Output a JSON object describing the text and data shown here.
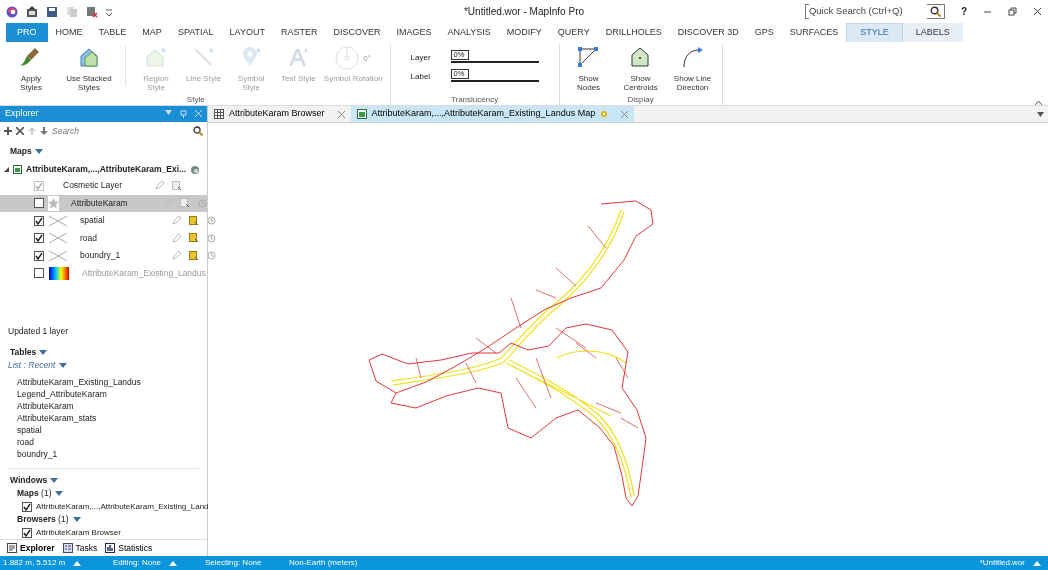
{
  "window": {
    "title": "*Untitled.wor - MapInfo Pro",
    "quick_search": {
      "placeholder": "Quick Search (Ctrl+Q)"
    },
    "help": "?"
  },
  "ribbon_tabs": [
    {
      "label": "PRO",
      "kind": "app",
      "selected": false
    },
    {
      "label": "HOME",
      "kind": "tab",
      "selected": false
    },
    {
      "label": "TABLE",
      "kind": "tab",
      "selected": false
    },
    {
      "label": "MAP",
      "kind": "tab",
      "selected": false
    },
    {
      "label": "SPATIAL",
      "kind": "tab",
      "selected": false
    },
    {
      "label": "LAYOUT",
      "kind": "tab",
      "selected": false
    },
    {
      "label": "RASTER",
      "kind": "tab",
      "selected": false
    },
    {
      "label": "DISCOVER",
      "kind": "tab",
      "selected": false
    },
    {
      "label": "IMAGES",
      "kind": "tab",
      "selected": false
    },
    {
      "label": "ANALYSIS",
      "kind": "tab",
      "selected": false
    },
    {
      "label": "MODIFY",
      "kind": "tab",
      "selected": false
    },
    {
      "label": "QUERY",
      "kind": "tab",
      "selected": false
    },
    {
      "label": "DRILLHOLES",
      "kind": "tab",
      "selected": false
    },
    {
      "label": "DISCOVER 3D",
      "kind": "tab",
      "selected": false
    },
    {
      "label": "GPS",
      "kind": "tab",
      "selected": false
    },
    {
      "label": "SURFACES",
      "kind": "tab",
      "selected": false
    },
    {
      "label": "STYLE",
      "kind": "contextual",
      "selected": true
    },
    {
      "label": "LABELS",
      "kind": "contextual",
      "selected": false
    }
  ],
  "ribbon_groups": [
    {
      "label": "Style",
      "kind": "buttons",
      "buttons": [
        {
          "label": "Apply Styles",
          "kind": "brush",
          "disabled": false
        },
        {
          "label": "Use Stacked Styles",
          "kind": "stacked",
          "disabled": false
        },
        {
          "label": "Region Style",
          "kind": "region",
          "disabled": true
        },
        {
          "label": "Line Style",
          "kind": "line",
          "disabled": true
        },
        {
          "label": "Symbol Style",
          "kind": "symbol",
          "disabled": true
        },
        {
          "label": "Text Style",
          "kind": "text",
          "disabled": true
        },
        {
          "label": "Symbol Rotation",
          "kind": "rotation",
          "reading": "0°",
          "disabled": true
        }
      ]
    },
    {
      "label": "Translucency",
      "kind": "sliders",
      "sliders": [
        {
          "label": "Layer",
          "reading": "0%",
          "level": 0
        },
        {
          "label": "Label",
          "reading": "0%",
          "level": 0
        }
      ]
    },
    {
      "label": "Display",
      "kind": "buttons",
      "buttons": [
        {
          "label": "Show Nodes",
          "kind": "nodes",
          "disabled": false
        },
        {
          "label": "Show Centroids",
          "kind": "centroids",
          "disabled": false
        },
        {
          "label": "Show Line Direction",
          "kind": "direction",
          "disabled": false
        }
      ]
    }
  ],
  "explorer": {
    "title": "Explorer",
    "search": {
      "placeholder": "Search"
    },
    "maps_heading": "Maps",
    "map_name": "AttributeKaram,...,AttributeKaram_Exi...",
    "layers": [
      {
        "name": "Cosmetic Layer",
        "kind": "cosmetic",
        "checked": true,
        "disabled": true,
        "selected": false,
        "selectable": false,
        "dimmed": false
      },
      {
        "name": "AttributeKaram",
        "kind": "points",
        "checked": false,
        "disabled": false,
        "selected": true,
        "selectable": false,
        "dimmed": false
      },
      {
        "name": "spatial",
        "kind": "lines",
        "checked": true,
        "disabled": false,
        "selected": false,
        "selectable": true,
        "dimmed": false
      },
      {
        "name": "road",
        "kind": "lines",
        "checked": true,
        "disabled": false,
        "selected": false,
        "selectable": true,
        "dimmed": false
      },
      {
        "name": "boundry_1",
        "kind": "lines",
        "checked": true,
        "disabled": false,
        "selected": false,
        "selectable": true,
        "dimmed": false
      },
      {
        "name": "AttributeKaram_Existing_Landus",
        "kind": "theme",
        "checked": false,
        "disabled": false,
        "selected": false,
        "dimmed": true
      }
    ],
    "message": "Updated 1 layer",
    "tables_heading": "Tables",
    "tables_filter": "List : Recent",
    "tables": [
      "AttributeKaram_Existing_Landus",
      "Legend_AttributeKaram",
      "AttributeKaram",
      "AttributeKaram_stats",
      "spatial",
      "road",
      "boundry_1"
    ],
    "windows_heading": "Windows",
    "window_groups": [
      {
        "label": "Maps",
        "count": "(1)",
        "items": [
          {
            "name": "AttributeKaram,...,AttributeKaram_Existing_Land",
            "checked": true
          }
        ]
      },
      {
        "label": "Browsers",
        "count": "(1)",
        "items": [
          {
            "name": "AttributeKaram Browser",
            "checked": true
          }
        ]
      }
    ],
    "bottom_tabs": [
      {
        "label": "Explorer",
        "selected": true
      },
      {
        "label": "Tasks",
        "selected": false
      },
      {
        "label": "Statistics",
        "selected": false
      }
    ]
  },
  "document_tabs": [
    {
      "label": "AttributeKaram Browser",
      "kind": "browser",
      "selected": false
    },
    {
      "label": "AttributeKaram,...,AttributeKaram_Existing_Landus Map",
      "kind": "map",
      "selected": true
    }
  ],
  "status_bar": {
    "coordinates": "1.882 m, 5.512 m",
    "editing": "Editing: None",
    "selecting": "Selecting: None",
    "projection": "Non-Earth (meters)",
    "workspace": "*Untitled.wor"
  }
}
